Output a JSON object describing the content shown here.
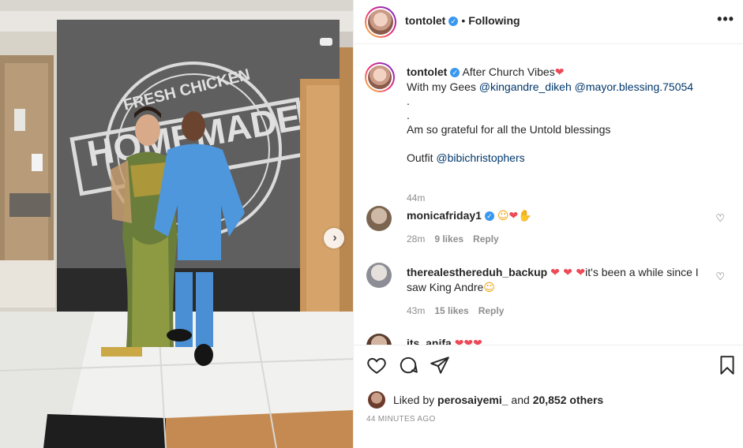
{
  "post": {
    "username": "tontolet",
    "follow_state": "Following",
    "more_label": "•••"
  },
  "caption": {
    "username": "tontolet",
    "line1": "After Church Vibes",
    "line2_prefix": "With my Gees ",
    "mention1": "@kingandre_dikeh",
    "mention2": "@mayor.blessing.75054",
    "dot1": ".",
    "dot2": ".",
    "line3": "Am so grateful for all the Untold blessings",
    "line4_prefix": "Outfit ",
    "mention3": "@bibichristophers",
    "time": "44m"
  },
  "comments": [
    {
      "username": "monicafriday1",
      "text": "",
      "time": "28m",
      "likes": "9 likes",
      "reply": "Reply"
    },
    {
      "username": "therealesthereduh_backup",
      "text": "it's been a while since I saw King Andre",
      "time": "43m",
      "likes": "15 likes",
      "reply": "Reply"
    },
    {
      "username": "its_anifa",
      "text": ""
    }
  ],
  "photo": {
    "wall_text_top": "FRESH CHICKEN",
    "wall_text_mid": "HOMEMADE"
  },
  "likes": {
    "prefix": "Liked by ",
    "user": "perosaiyemi_",
    "middle": " and ",
    "count": "20,852 others"
  },
  "timestamp": "44 MINUTES AGO",
  "colors": {
    "accent": "#3897f0",
    "heart": "#ed4956",
    "mention": "#00376b"
  }
}
